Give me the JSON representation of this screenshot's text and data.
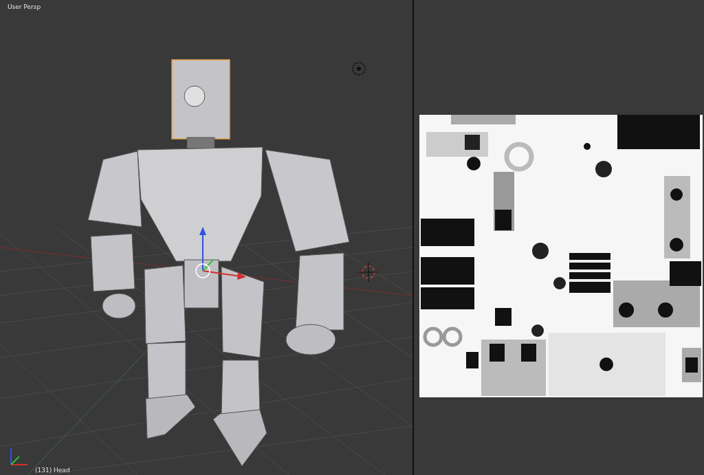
{
  "viewport": {
    "view_label": "User Persp",
    "object_label": "(131) Head"
  }
}
